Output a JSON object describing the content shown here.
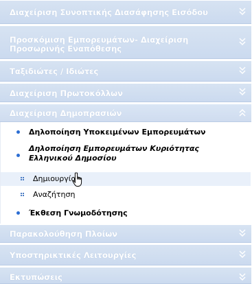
{
  "sections": [
    {
      "label": "Διαχείριση Συνοπτικής Διασάφησης Εισόδου",
      "expanded": false
    },
    {
      "label": "Προσκόμιση Εμπορευμάτων- Διαχείριση Προσωρινής Εναπόθεσης",
      "expanded": false
    },
    {
      "label": "Ταξιδιώτες / Ιδιώτες",
      "expanded": false
    },
    {
      "label": "Διαχείριση Πρωτοκόλλων",
      "expanded": false
    },
    {
      "label": "Διαχείριση Δημοπρασιών",
      "expanded": true
    },
    {
      "label": "Παρακολούθηση Πλοίων",
      "expanded": false
    },
    {
      "label": "Υποστηρικτικές Λειτουργίες",
      "expanded": false
    },
    {
      "label": "Εκτυπώσεις",
      "expanded": false
    }
  ],
  "auctions_submenu": {
    "items": [
      {
        "label": "Δηλοποίηση Υποκειμένων Εμπορευμάτων"
      },
      {
        "label": "Δηλοποίηση Εμπορευμάτων Κυριότητας Ελληνικού Δημοσίου"
      },
      {
        "label": "Έκθεση Γνωμοδότησης"
      }
    ],
    "children": [
      {
        "label": "Δημιουργία"
      },
      {
        "label": "Αναζήτηση"
      }
    ]
  },
  "colors": {
    "header_bg": "#cfdcef",
    "header_text": "#ffffff",
    "bullet": "#2c6ed3",
    "hover_row": "#e9f0fa"
  }
}
